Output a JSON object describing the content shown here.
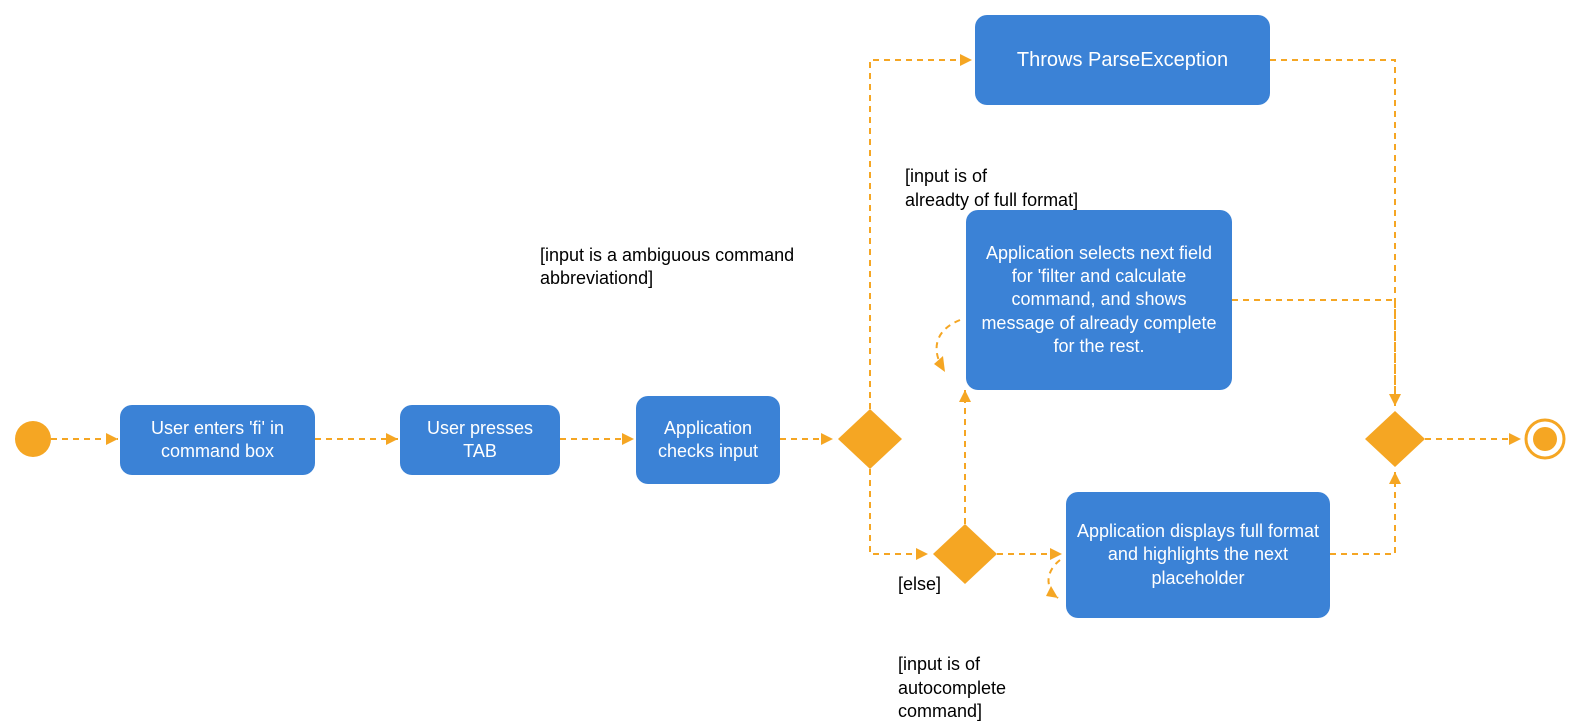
{
  "nodes": {
    "n1": "User enters 'fi' in command box",
    "n2": "User presses TAB",
    "n3": "Application checks input",
    "n4": "Throws ParseException",
    "n5": "Application selects next field for 'filter and calculate command, and shows message of already complete for the rest.",
    "n6": "Application displays full format and highlights the next placeholder"
  },
  "labels": {
    "l1": "[input is a ambiguous command abbreviationd]",
    "l2": "[input is of\n alreadty of full format]",
    "l3": "[else]",
    "l4": "[input is of\n autocomplete\n command]"
  },
  "colors": {
    "node": "#3b82d6",
    "accent": "#f5a623"
  }
}
